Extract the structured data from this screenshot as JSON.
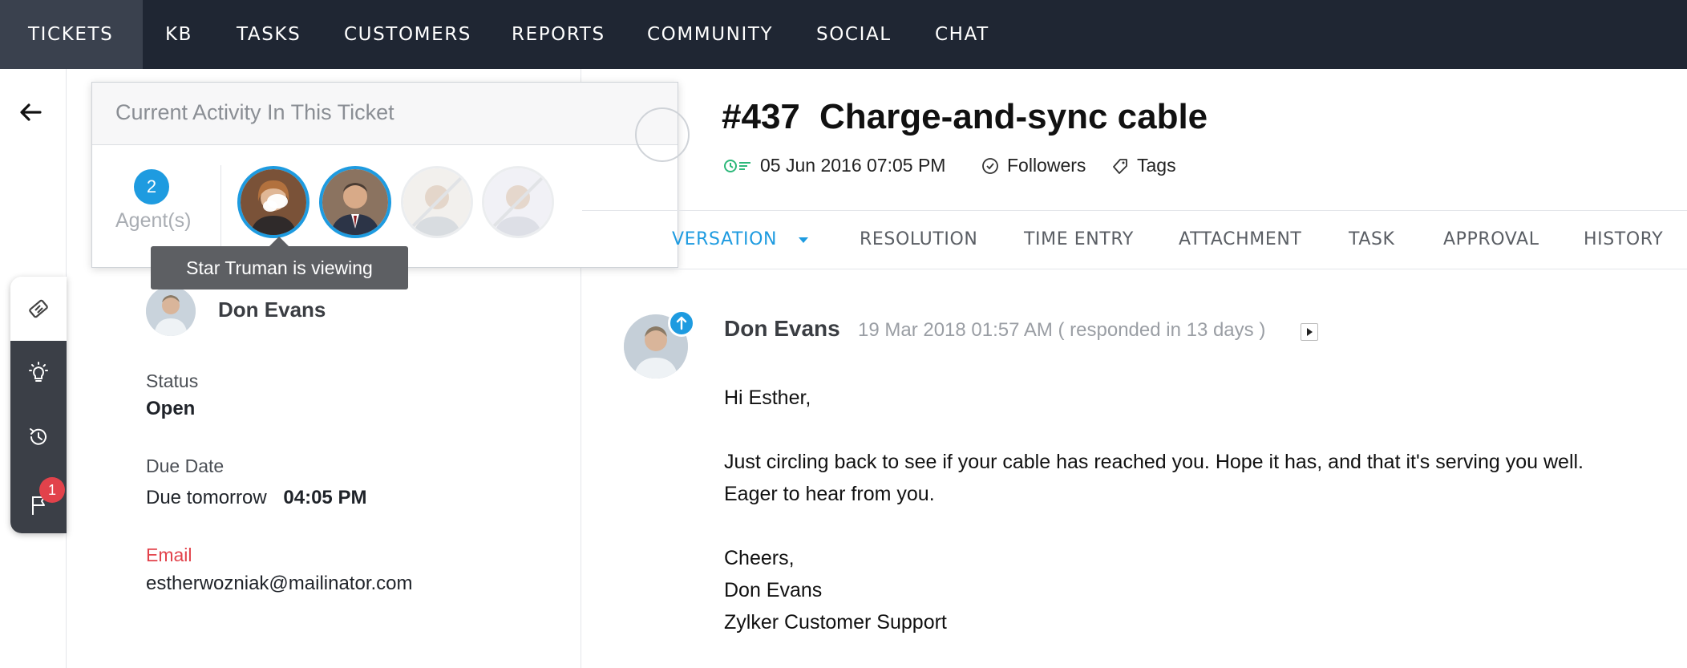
{
  "nav": {
    "items": [
      "TICKETS",
      "KB",
      "TASKS",
      "CUSTOMERS",
      "REPORTS",
      "COMMUNITY",
      "SOCIAL",
      "CHAT"
    ],
    "active": "TICKETS"
  },
  "activity_popup": {
    "title": "Current Activity In This Ticket",
    "agent_count": "2",
    "agent_label": "Agent(s)",
    "tooltip": "Star Truman is viewing"
  },
  "contact": {
    "name": "Don Evans",
    "status_label": "Status",
    "status_value": "Open",
    "due_label": "Due Date",
    "due_value": "Due tomorrow",
    "due_time": "04:05 PM",
    "email_label": "Email",
    "email_value": "estherwozniak@mailinator.com"
  },
  "sidetools": {
    "notification_count": "1"
  },
  "ticket": {
    "number": "#437",
    "title": "Charge-and-sync cable",
    "created": "05 Jun 2016 07:05 PM",
    "followers_label": "Followers",
    "tags_label": "Tags"
  },
  "tabs": [
    {
      "label": "VERSATION",
      "active": true
    },
    {
      "label": "RESOLUTION",
      "active": false
    },
    {
      "label": "TIME ENTRY",
      "active": false
    },
    {
      "label": "ATTACHMENT",
      "active": false
    },
    {
      "label": "TASK",
      "active": false
    },
    {
      "label": "APPROVAL",
      "active": false
    },
    {
      "label": "HISTORY",
      "active": false
    }
  ],
  "message": {
    "author": "Don Evans",
    "time": "19 Mar 2018 01:57 AM ( responded in 13 days )",
    "lines": [
      "Hi Esther,",
      "Just circling back to see if your cable has reached you. Hope it has, and that it's serving you well.",
      "Eager to hear from you.",
      "Cheers,",
      "Don Evans",
      "Zylker Customer Support"
    ]
  },
  "colors": {
    "nav_bg": "#1f2633",
    "accent": "#1e9be0",
    "email_label": "#e2424b",
    "badge": "#e2424b"
  }
}
